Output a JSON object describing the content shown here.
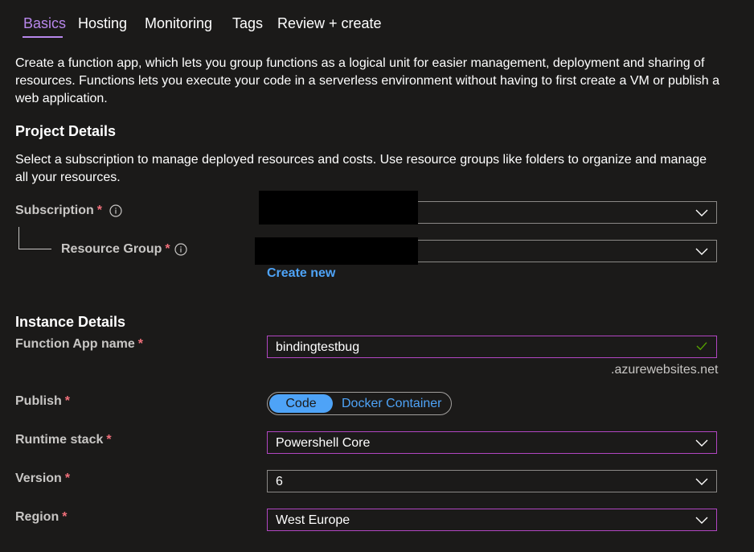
{
  "tabs": [
    {
      "label": "Basics"
    },
    {
      "label": "Hosting"
    },
    {
      "label": "Monitoring"
    },
    {
      "label": "Tags"
    },
    {
      "label": "Review + create"
    }
  ],
  "intro": "Create a function app, which lets you group functions as a logical unit for easier management, deployment and sharing of resources. Functions lets you execute your code in a serverless environment without having to first create a VM or publish a web application.",
  "project": {
    "heading": "Project Details",
    "description": "Select a subscription to manage deployed resources and costs. Use resource groups like folders to organize and manage all your resources.",
    "subscription_label": "Subscription",
    "resource_group_label": "Resource Group",
    "create_new": "Create new"
  },
  "instance": {
    "heading": "Instance Details",
    "app_name_label": "Function App name",
    "app_name_value": "bindingtestbug",
    "app_name_suffix": ".azurewebsites.net",
    "publish_label": "Publish",
    "publish_options": [
      "Code",
      "Docker Container"
    ],
    "runtime_label": "Runtime stack",
    "runtime_value": "Powershell Core",
    "version_label": "Version",
    "version_value": "6",
    "region_label": "Region",
    "region_value": "West Europe"
  },
  "required_marker": "*",
  "colors": {
    "accent_tab": "#b887ec",
    "link": "#4ea3f7",
    "required": "#f1707b",
    "focus_border": "#b146c2",
    "valid_check": "#57a300"
  },
  "icons": {
    "info": "info-icon",
    "chevron": "chevron-down-icon",
    "check": "checkmark-icon"
  }
}
